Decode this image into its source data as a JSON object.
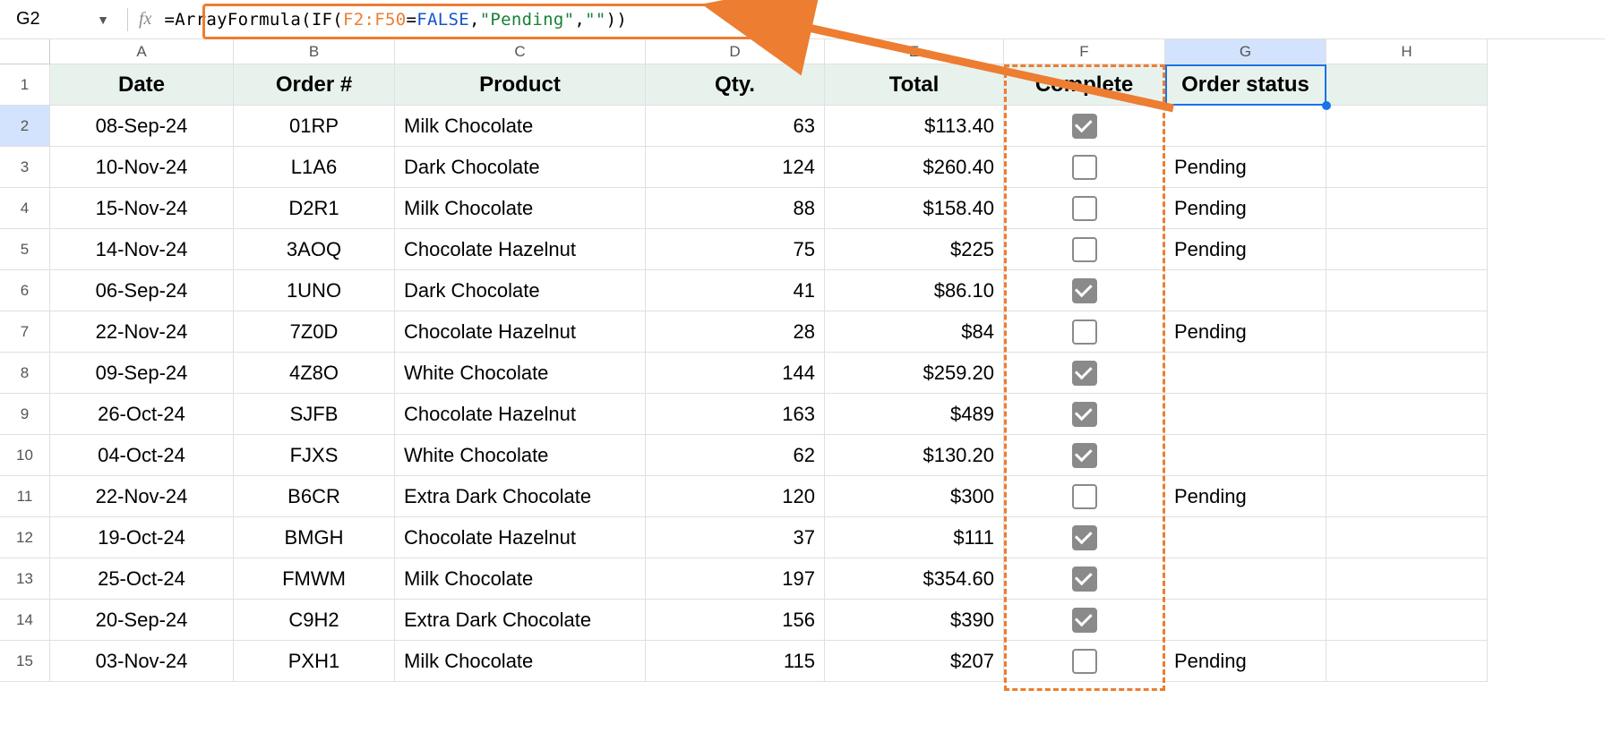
{
  "name_box": "G2",
  "formula_parts": {
    "eq": "=",
    "fn1": "ArrayFormula",
    "p1": "(",
    "fn2": "IF",
    "p2": "(",
    "ref": "F2:F50",
    "eq2": "=",
    "bool": "FALSE",
    "c1": ",",
    "str1": "\"Pending\"",
    "c2": ",",
    "str2": "\"\"",
    "p3": ")",
    "p4": ")"
  },
  "col_labels": [
    "A",
    "B",
    "C",
    "D",
    "E",
    "F",
    "G",
    "H"
  ],
  "row_labels": [
    "1",
    "2",
    "3",
    "4",
    "5",
    "6",
    "7",
    "8",
    "9",
    "10",
    "11",
    "12",
    "13",
    "14",
    "15"
  ],
  "headers": {
    "date": "Date",
    "order": "Order #",
    "product": "Product",
    "qty": "Qty.",
    "total": "Total",
    "complete": "Complete",
    "status": "Order status"
  },
  "rows": [
    {
      "date": "08-Sep-24",
      "order": "01RP",
      "product": "Milk Chocolate",
      "qty": "63",
      "total": "$113.40",
      "complete": true,
      "status": ""
    },
    {
      "date": "10-Nov-24",
      "order": "L1A6",
      "product": "Dark Chocolate",
      "qty": "124",
      "total": "$260.40",
      "complete": false,
      "status": "Pending"
    },
    {
      "date": "15-Nov-24",
      "order": "D2R1",
      "product": "Milk Chocolate",
      "qty": "88",
      "total": "$158.40",
      "complete": false,
      "status": "Pending"
    },
    {
      "date": "14-Nov-24",
      "order": "3AOQ",
      "product": "Chocolate Hazelnut",
      "qty": "75",
      "total": "$225",
      "complete": false,
      "status": "Pending"
    },
    {
      "date": "06-Sep-24",
      "order": "1UNO",
      "product": "Dark Chocolate",
      "qty": "41",
      "total": "$86.10",
      "complete": true,
      "status": ""
    },
    {
      "date": "22-Nov-24",
      "order": "7Z0D",
      "product": "Chocolate Hazelnut",
      "qty": "28",
      "total": "$84",
      "complete": false,
      "status": "Pending"
    },
    {
      "date": "09-Sep-24",
      "order": "4Z8O",
      "product": "White Chocolate",
      "qty": "144",
      "total": "$259.20",
      "complete": true,
      "status": ""
    },
    {
      "date": "26-Oct-24",
      "order": "SJFB",
      "product": "Chocolate Hazelnut",
      "qty": "163",
      "total": "$489",
      "complete": true,
      "status": ""
    },
    {
      "date": "04-Oct-24",
      "order": "FJXS",
      "product": "White Chocolate",
      "qty": "62",
      "total": "$130.20",
      "complete": true,
      "status": ""
    },
    {
      "date": "22-Nov-24",
      "order": "B6CR",
      "product": "Extra Dark Chocolate",
      "qty": "120",
      "total": "$300",
      "complete": false,
      "status": "Pending"
    },
    {
      "date": "19-Oct-24",
      "order": "BMGH",
      "product": "Chocolate Hazelnut",
      "qty": "37",
      "total": "$111",
      "complete": true,
      "status": ""
    },
    {
      "date": "25-Oct-24",
      "order": "FMWM",
      "product": "Milk Chocolate",
      "qty": "197",
      "total": "$354.60",
      "complete": true,
      "status": ""
    },
    {
      "date": "20-Sep-24",
      "order": "C9H2",
      "product": "Extra Dark Chocolate",
      "qty": "156",
      "total": "$390",
      "complete": true,
      "status": ""
    },
    {
      "date": "03-Nov-24",
      "order": "PXH1",
      "product": "Milk Chocolate",
      "qty": "115",
      "total": "$207",
      "complete": false,
      "status": "Pending"
    }
  ],
  "selected_col_index": 6,
  "selected_row_index": 1,
  "colors": {
    "accent": "#ed7d31",
    "blue": "#1a73e8"
  }
}
